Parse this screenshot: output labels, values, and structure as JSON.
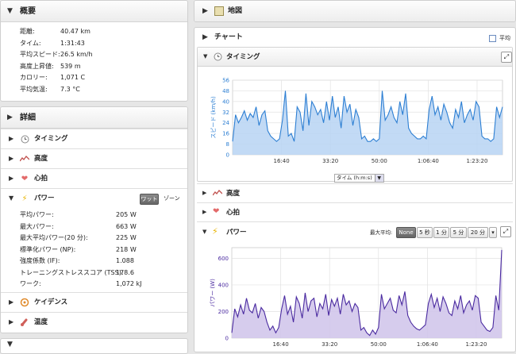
{
  "summary": {
    "title": "概要",
    "rows": [
      {
        "label": "距離:",
        "value": "40.47 km"
      },
      {
        "label": "タイム:",
        "value": "1:31:43"
      },
      {
        "label": "平均スピード:",
        "value": "26.5 km/h"
      },
      {
        "label": "高度上昇値:",
        "value": "539 m"
      },
      {
        "label": "カロリー:",
        "value": "1,071 C"
      },
      {
        "label": "平均気温:",
        "value": "7.3 °C"
      }
    ]
  },
  "details": {
    "title": "詳細",
    "sections": {
      "timing": "タイミング",
      "elevation": "高度",
      "heartrate": "心拍",
      "power": "パワー",
      "cadence": "ケイデンス",
      "temperature": "温度"
    },
    "power_toggle": {
      "watts": "ワット",
      "zones": "ゾーン"
    },
    "power_rows": [
      {
        "label": "平均パワー:",
        "value": "205 W"
      },
      {
        "label": "最大パワー:",
        "value": "663 W"
      },
      {
        "label": "最大平均パワー(20 分):",
        "value": "225 W"
      },
      {
        "label": "標準化パワー (NP):",
        "value": "218 W"
      },
      {
        "label": "強度係数 (IF):",
        "value": "1.088"
      },
      {
        "label": "トレーニングストレススコア (TSS):",
        "value": "178.6"
      },
      {
        "label": "ワーク:",
        "value": "1,072 kJ"
      }
    ]
  },
  "map": {
    "title": "地図"
  },
  "chart_panel": {
    "title": "チャート",
    "avg_label": "平均",
    "timing_label": "タイミング",
    "elevation_label": "高度",
    "heartrate_label": "心拍",
    "power_label": "パワー",
    "max_avg_label": "最大平均:",
    "max_avg_options": [
      "None",
      "5 秒",
      "1 分",
      "5 分",
      "20 分"
    ],
    "max_avg_selected": "None",
    "xaxis_select": "タイム (h:m:s)"
  },
  "colors": {
    "speed": "#2d7fd3",
    "speed_fill": "#b7d4f3",
    "power": "#4a2aa0",
    "power_fill": "#cfc3ea"
  },
  "chart_data": [
    {
      "type": "area",
      "ylabel": "スピード (km/h)",
      "xlabel": "タイム (h:m:s)",
      "x_ticks": [
        "16:40",
        "33:20",
        "50:00",
        "1:06:40",
        "1:23:20"
      ],
      "x_tick_minutes": [
        16.67,
        33.33,
        50.0,
        66.67,
        83.33
      ],
      "y_ticks": [
        0,
        8,
        16,
        24,
        32,
        40,
        48,
        56
      ],
      "xlim": [
        0,
        92
      ],
      "ylim": [
        0,
        56
      ],
      "grid": true,
      "x": [
        0,
        1,
        2,
        3,
        4,
        5,
        6,
        7,
        8,
        9,
        10,
        11,
        12,
        13,
        14,
        15,
        16,
        17,
        18,
        19,
        20,
        21,
        22,
        23,
        24,
        25,
        26,
        27,
        28,
        29,
        30,
        31,
        32,
        33,
        34,
        35,
        36,
        37,
        38,
        39,
        40,
        41,
        42,
        43,
        44,
        45,
        46,
        47,
        48,
        49,
        50,
        51,
        52,
        53,
        54,
        55,
        56,
        57,
        58,
        59,
        60,
        61,
        62,
        63,
        64,
        65,
        66,
        67,
        68,
        69,
        70,
        71,
        72,
        73,
        74,
        75,
        76,
        77,
        78,
        79,
        80,
        81,
        82,
        83,
        84,
        85,
        86,
        87,
        88,
        89,
        90,
        91,
        92
      ],
      "values": [
        10,
        30,
        24,
        28,
        33,
        26,
        31,
        28,
        36,
        22,
        30,
        33,
        18,
        14,
        12,
        10,
        12,
        26,
        48,
        14,
        16,
        10,
        36,
        32,
        18,
        46,
        22,
        40,
        36,
        30,
        34,
        24,
        40,
        26,
        44,
        28,
        36,
        20,
        44,
        32,
        38,
        22,
        34,
        28,
        12,
        14,
        10,
        10,
        12,
        10,
        12,
        48,
        26,
        30,
        36,
        28,
        24,
        40,
        30,
        46,
        20,
        16,
        14,
        12,
        12,
        14,
        12,
        34,
        44,
        30,
        36,
        26,
        38,
        32,
        24,
        20,
        34,
        28,
        40,
        24,
        30,
        34,
        26,
        40,
        36,
        14,
        12,
        12,
        10,
        12,
        36,
        28,
        36
      ]
    },
    {
      "type": "area",
      "ylabel": "パワー (W)",
      "xlabel": "タイム (h:m:s)",
      "x_ticks": [
        "16:40",
        "33:20",
        "50:00",
        "1:06:40",
        "1:23:20"
      ],
      "x_tick_minutes": [
        16.67,
        33.33,
        50.0,
        66.67,
        83.33
      ],
      "y_ticks": [
        0,
        200,
        400,
        600
      ],
      "xlim": [
        0,
        92
      ],
      "ylim": [
        0,
        680
      ],
      "grid": true,
      "x": [
        0,
        1,
        2,
        3,
        4,
        5,
        6,
        7,
        8,
        9,
        10,
        11,
        12,
        13,
        14,
        15,
        16,
        17,
        18,
        19,
        20,
        21,
        22,
        23,
        24,
        25,
        26,
        27,
        28,
        29,
        30,
        31,
        32,
        33,
        34,
        35,
        36,
        37,
        38,
        39,
        40,
        41,
        42,
        43,
        44,
        45,
        46,
        47,
        48,
        49,
        50,
        51,
        52,
        53,
        54,
        55,
        56,
        57,
        58,
        59,
        60,
        61,
        62,
        63,
        64,
        65,
        66,
        67,
        68,
        69,
        70,
        71,
        72,
        73,
        74,
        75,
        76,
        77,
        78,
        79,
        80,
        81,
        82,
        83,
        84,
        85,
        86,
        87,
        88,
        89,
        90,
        91,
        92
      ],
      "values": [
        40,
        220,
        160,
        250,
        180,
        300,
        210,
        190,
        260,
        150,
        230,
        200,
        120,
        60,
        90,
        40,
        80,
        220,
        320,
        180,
        240,
        120,
        310,
        260,
        150,
        340,
        200,
        280,
        300,
        160,
        260,
        220,
        330,
        170,
        290,
        240,
        300,
        180,
        330,
        250,
        280,
        200,
        260,
        230,
        60,
        80,
        40,
        20,
        60,
        30,
        80,
        330,
        220,
        260,
        300,
        210,
        190,
        320,
        250,
        350,
        170,
        120,
        90,
        70,
        60,
        80,
        100,
        260,
        330,
        230,
        300,
        200,
        310,
        260,
        190,
        170,
        280,
        220,
        320,
        190,
        250,
        280,
        210,
        320,
        300,
        120,
        90,
        60,
        50,
        80,
        320,
        210,
        663
      ]
    }
  ]
}
